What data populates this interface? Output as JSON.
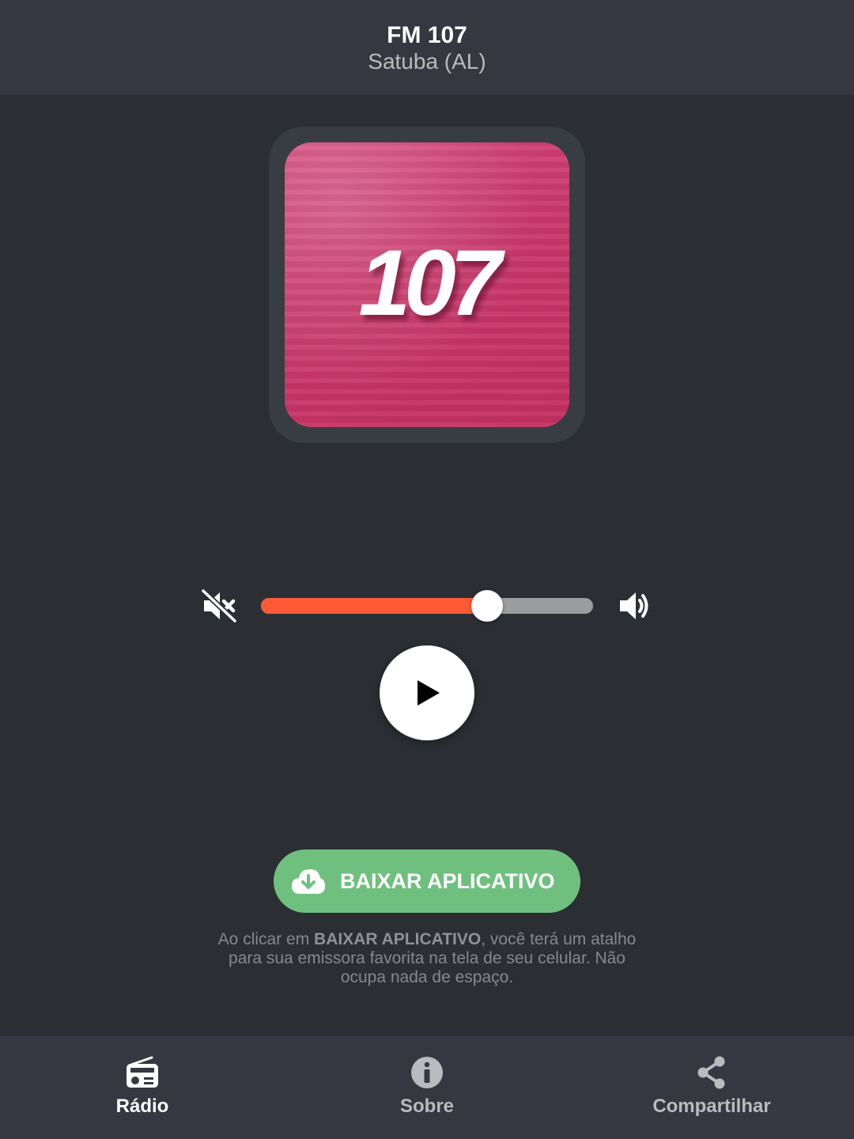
{
  "header": {
    "station_name": "FM 107",
    "location": "Satuba (AL)"
  },
  "logo": {
    "text": "107",
    "color": "#c8386a"
  },
  "player": {
    "volume_percent": 68,
    "accent_color": "#ff5a36",
    "mute_icon": "volume-mute-icon",
    "volume_icon": "volume-up-icon",
    "play_icon": "play-icon"
  },
  "download": {
    "button_label": "BAIXAR APLICATIVO",
    "icon": "cloud-download-icon",
    "color": "#6fc07e",
    "disclaimer_pre": "Ao clicar em ",
    "disclaimer_bold": "BAIXAR APLICATIVO",
    "disclaimer_post": ", você terá um atalho para sua emissora favorita na tela de seu celular. Não ocupa nada de espaço."
  },
  "nav": {
    "items": [
      {
        "label": "Rádio",
        "icon": "radio-icon",
        "active": true
      },
      {
        "label": "Sobre",
        "icon": "info-icon",
        "active": false
      },
      {
        "label": "Compartilhar",
        "icon": "share-icon",
        "active": false
      }
    ]
  }
}
